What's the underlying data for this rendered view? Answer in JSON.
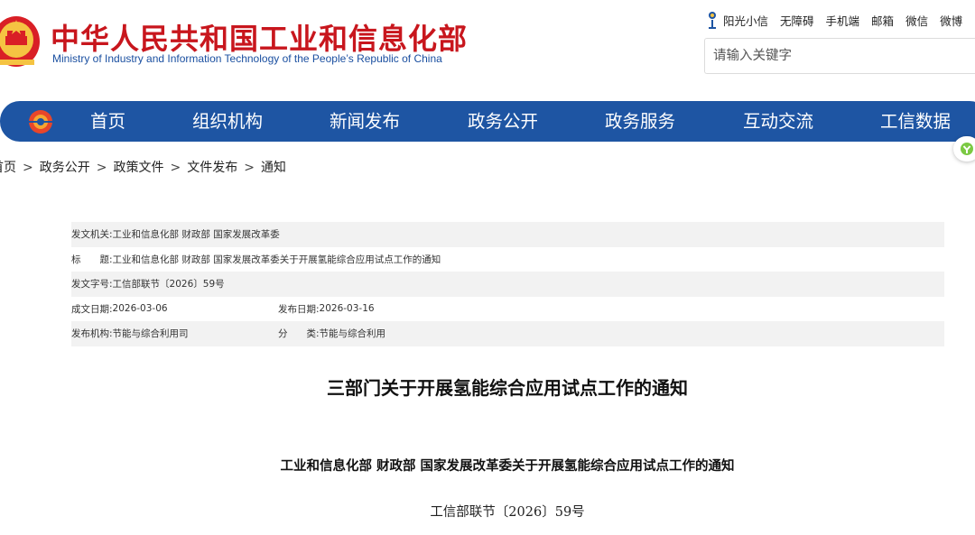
{
  "header": {
    "title_cn": "中华人民共和国工业和信息化部",
    "title_en": "Ministry of Industry and Information Technology of the People’s Republic of China",
    "top_links": [
      "阳光小信",
      "无障碍",
      "手机端",
      "邮箱",
      "微信",
      "微博"
    ],
    "search_placeholder": "请输入关键字"
  },
  "nav": {
    "items": [
      "首页",
      "组织机构",
      "新闻发布",
      "政务公开",
      "政务服务",
      "互动交流",
      "工信数据"
    ]
  },
  "breadcrumb": {
    "items": [
      "首页",
      "政务公开",
      "政策文件",
      "文件发布",
      "通知"
    ],
    "separator": ">"
  },
  "info": {
    "issuer_label": "发文机关:",
    "issuer": "工业和信息化部 财政部 国家发展改革委",
    "title_label": "标　　题:",
    "title": "工业和信息化部 财政部 国家发展改革委关于开展氢能综合应用试点工作的通知",
    "doc_no_label": "发文字号:",
    "doc_no": "工信部联节〔2026〕59号",
    "created_label": "成文日期:",
    "created": "2026-03-06",
    "published_label": "发布日期:",
    "published": "2026-03-16",
    "org_label": "发布机构:",
    "org": "节能与综合利用司",
    "category_label": "分　　类:",
    "category": "节能与综合利用"
  },
  "article": {
    "title": "三部门关于开展氢能综合应用试点工作的通知",
    "subtitle": "工业和信息化部 财政部 国家发展改革委关于开展氢能综合应用试点工作的通知",
    "doc_number": "工信部联节〔2026〕59号"
  },
  "colors": {
    "brand_red": "#c8161d",
    "nav_blue": "#1e55a3",
    "english_blue": "#1a4fa0"
  },
  "icons": {
    "emblem": "national-emblem-icon",
    "sun": "sunshine-icon",
    "nav_logo": "miit-logo-icon",
    "side": "side-widget-icon"
  }
}
